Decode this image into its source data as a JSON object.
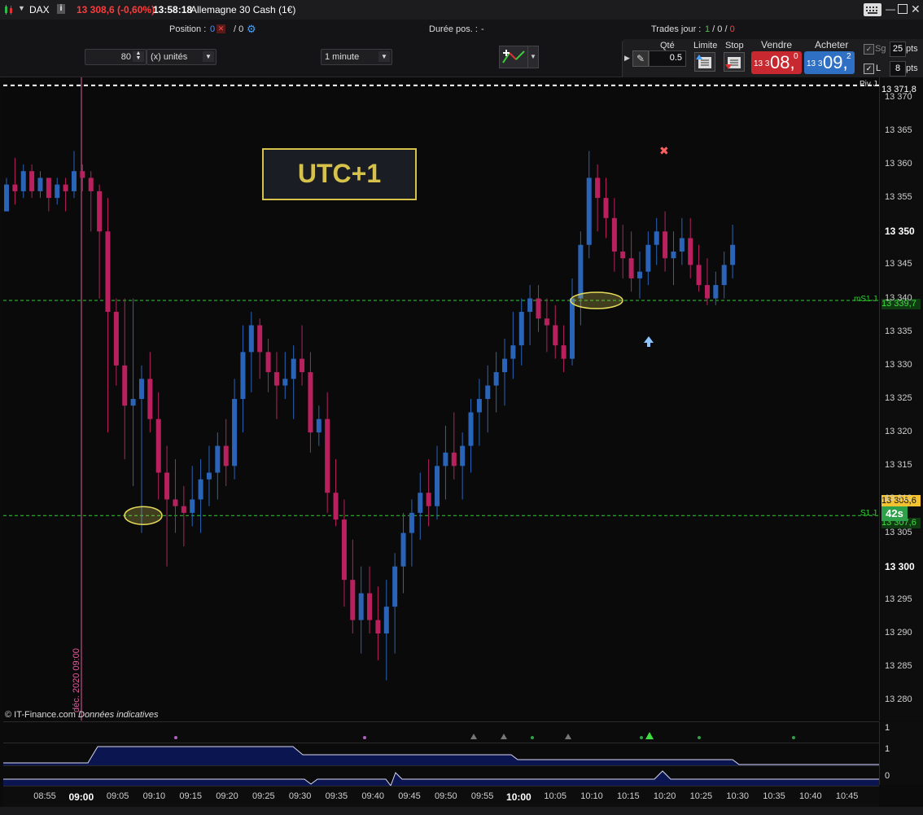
{
  "titlebar": {
    "symbol": "DAX",
    "info_icon": "i",
    "price_change": "13 308,6 (-0,60%)",
    "time": "13:58:18",
    "instrument": "Allemagne 30 Cash (1€)"
  },
  "toolbar": {
    "position_label": "Position :",
    "position_value": "0",
    "position_value2": "/ 0",
    "duree_label": "Durée pos. :",
    "duree_value": "-",
    "trades_label": "Trades jour :",
    "trades_green": "1",
    "trades_mid": "0",
    "trades_red": "0",
    "units_value": "80",
    "units_type": "(x) unités",
    "timeframe": "1 minute",
    "qty_label": "Qté",
    "qty_value": "0.5",
    "limit_label": "Limite",
    "stop_label": "Stop",
    "sell_label": "Vendre",
    "sell_small": "13 3",
    "sell_big": "08,",
    "sell_sup": "0",
    "buy_label": "Acheter",
    "buy_small": "13 3",
    "buy_big": "09,",
    "buy_sup": "2",
    "sg_label": "Sg",
    "sg_value": "25",
    "sg_unit": "pts",
    "l_label": "L",
    "l_value": "8",
    "l_unit": "pts"
  },
  "chart": {
    "annotation": "UTC+1",
    "copyright": "© IT-Finance.com",
    "copyright_note": "Données indicatives",
    "vertical_label": "déc. 2020 09:00",
    "piv_label": "Piv J",
    "piv_value": "13 371,8",
    "ms1_label": "mS1 J",
    "ms1_value": "13 339,7",
    "s1_label": "S1 J",
    "s1_value": "13 307,6",
    "last_price": "13 308,6",
    "countdown": "42s",
    "colors": {
      "bull": "#2a64b8",
      "bear": "#b8215e",
      "dotted_green": "#2fd02f",
      "pivot_white": "#ffffff"
    }
  },
  "y_axis": {
    "labels": [
      "13 370",
      "13 365",
      "13 360",
      "13 355",
      "13 350",
      "13 345",
      "13 340",
      "13 335",
      "13 330",
      "13 325",
      "13 320",
      "13 315",
      "13 310",
      "13 305",
      "13 300",
      "13 295",
      "13 290",
      "13 285",
      "13 280"
    ],
    "bold": [
      "13 350",
      "13 300"
    ]
  },
  "indicators": {
    "ind1_label": "1",
    "ind2_label": "1",
    "ind3_label": "0"
  },
  "x_axis": {
    "labels": [
      "08:55",
      "09:00",
      "09:05",
      "09:10",
      "09:15",
      "09:20",
      "09:25",
      "09:30",
      "09:35",
      "09:40",
      "09:45",
      "09:50",
      "09:55",
      "10:00",
      "10:05",
      "10:10",
      "10:15",
      "10:20",
      "10:25",
      "10:30",
      "10:35",
      "10:40",
      "10:45"
    ],
    "bold": [
      "09:00",
      "10:00"
    ]
  },
  "chart_data": {
    "type": "candlestick",
    "title": "",
    "xlabel": "",
    "ylabel": "",
    "ylim": [
      13277,
      13373
    ],
    "reference_lines": [
      {
        "name": "Piv J",
        "value": 13371.8
      },
      {
        "name": "mS1 J",
        "value": 13339.7
      },
      {
        "name": "S1 J",
        "value": 13307.6
      }
    ],
    "last_price": 13308.6,
    "candles": [
      [
        13353,
        13358,
        13353,
        13357
      ],
      [
        13357,
        13361,
        13354,
        13356
      ],
      [
        13356,
        13360,
        13355,
        13359
      ],
      [
        13359,
        13360,
        13355,
        13356
      ],
      [
        13356,
        13359,
        13355,
        13358
      ],
      [
        13358,
        13358,
        13353,
        13355
      ],
      [
        13355,
        13358,
        13354,
        13357
      ],
      [
        13357,
        13358,
        13353,
        13356
      ],
      [
        13356,
        13362,
        13355,
        13359
      ],
      [
        13359,
        13360,
        13356,
        13358
      ],
      [
        13358,
        13359,
        13350,
        13356
      ],
      [
        13356,
        13357,
        13340,
        13350
      ],
      [
        13350,
        13355,
        13320,
        13338
      ],
      [
        13338,
        13340,
        13327,
        13330
      ],
      [
        13330,
        13340,
        13316,
        13324
      ],
      [
        13324,
        13340,
        13312,
        13325
      ],
      [
        13325,
        13330,
        13305,
        13328
      ],
      [
        13328,
        13332,
        13320,
        13322
      ],
      [
        13322,
        13326,
        13310,
        13314
      ],
      [
        13314,
        13318,
        13300,
        13310
      ],
      [
        13310,
        13316,
        13305,
        13309
      ],
      [
        13309,
        13312,
        13303,
        13308
      ],
      [
        13308,
        13315,
        13306,
        13310
      ],
      [
        13310,
        13316,
        13305,
        13313
      ],
      [
        13313,
        13318,
        13309,
        13314
      ],
      [
        13314,
        13320,
        13310,
        13318
      ],
      [
        13318,
        13322,
        13312,
        13315
      ],
      [
        13315,
        13328,
        13313,
        13325
      ],
      [
        13325,
        13336,
        13320,
        13332
      ],
      [
        13332,
        13338,
        13326,
        13336
      ],
      [
        13336,
        13337,
        13328,
        13332
      ],
      [
        13332,
        13334,
        13326,
        13329
      ],
      [
        13329,
        13332,
        13322,
        13327
      ],
      [
        13327,
        13332,
        13325,
        13328
      ],
      [
        13328,
        13333,
        13322,
        13331
      ],
      [
        13331,
        13336,
        13327,
        13329
      ],
      [
        13329,
        13332,
        13317,
        13320
      ],
      [
        13320,
        13324,
        13318,
        13322
      ],
      [
        13322,
        13326,
        13308,
        13311
      ],
      [
        13311,
        13316,
        13306,
        13307
      ],
      [
        13307,
        13310,
        13294,
        13298
      ],
      [
        13298,
        13304,
        13290,
        13292
      ],
      [
        13292,
        13300,
        13287,
        13296
      ],
      [
        13296,
        13300,
        13290,
        13292
      ],
      [
        13292,
        13297,
        13286,
        13290
      ],
      [
        13290,
        13298,
        13283,
        13294
      ],
      [
        13294,
        13302,
        13287,
        13300
      ],
      [
        13300,
        13308,
        13296,
        13305
      ],
      [
        13305,
        13310,
        13300,
        13308
      ],
      [
        13308,
        13314,
        13304,
        13311
      ],
      [
        13311,
        13316,
        13306,
        13309
      ],
      [
        13309,
        13318,
        13307,
        13315
      ],
      [
        13315,
        13321,
        13310,
        13317
      ],
      [
        13317,
        13323,
        13313,
        13315
      ],
      [
        13315,
        13320,
        13310,
        13318
      ],
      [
        13318,
        13325,
        13314,
        13323
      ],
      [
        13323,
        13328,
        13318,
        13325
      ],
      [
        13325,
        13330,
        13320,
        13327
      ],
      [
        13327,
        13332,
        13323,
        13329
      ],
      [
        13329,
        13334,
        13324,
        13331
      ],
      [
        13331,
        13338,
        13328,
        13333
      ],
      [
        13333,
        13340,
        13330,
        13338
      ],
      [
        13338,
        13342,
        13333,
        13340
      ],
      [
        13340,
        13342,
        13335,
        13337
      ],
      [
        13337,
        13340,
        13332,
        13336
      ],
      [
        13336,
        13339,
        13331,
        13333
      ],
      [
        13333,
        13336,
        13329,
        13331
      ],
      [
        13331,
        13343,
        13330,
        13340
      ],
      [
        13340,
        13350,
        13336,
        13348
      ],
      [
        13348,
        13362,
        13346,
        13358
      ],
      [
        13358,
        13360,
        13350,
        13355
      ],
      [
        13355,
        13358,
        13349,
        13352
      ],
      [
        13352,
        13355,
        13344,
        13347
      ],
      [
        13347,
        13351,
        13343,
        13346
      ],
      [
        13346,
        13350,
        13341,
        13343
      ],
      [
        13343,
        13347,
        13340,
        13344
      ],
      [
        13344,
        13350,
        13342,
        13348
      ],
      [
        13348,
        13352,
        13345,
        13350
      ],
      [
        13350,
        13353,
        13344,
        13346
      ],
      [
        13346,
        13350,
        13342,
        13347
      ],
      [
        13347,
        13352,
        13345,
        13349
      ],
      [
        13349,
        13352,
        13343,
        13345
      ],
      [
        13345,
        13348,
        13341,
        13342
      ],
      [
        13342,
        13346,
        13339,
        13340
      ],
      [
        13340,
        13344,
        13339,
        13342
      ],
      [
        13342,
        13347,
        13340,
        13345
      ],
      [
        13345,
        13351,
        13343,
        13348
      ]
    ]
  }
}
